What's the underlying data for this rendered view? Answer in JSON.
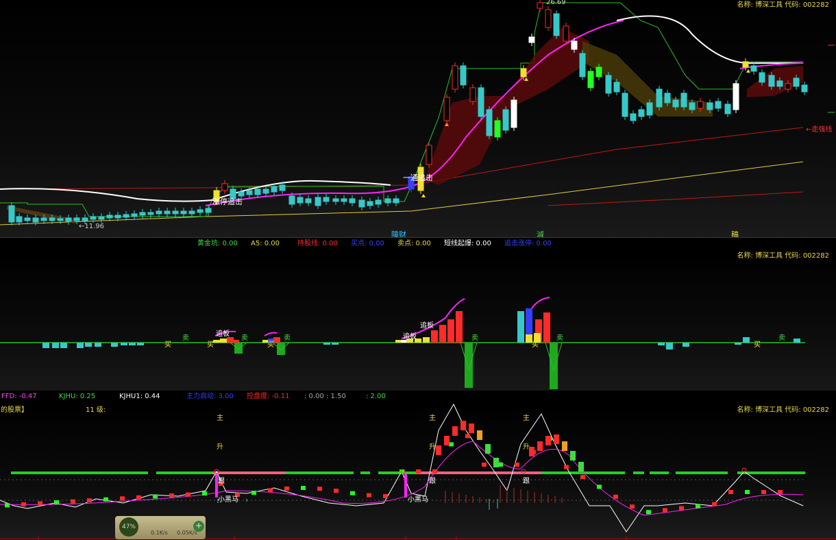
{
  "stock_title": "名称: 博深工具 代码: 002282",
  "panel1": {
    "price_high": "26.69",
    "price_low": "←11.96",
    "right_label": "←走强线",
    "chart_labels": [
      {
        "id": "zhangting",
        "text": "涨停追击"
      },
      {
        "id": "tuo",
        "text": "一通追击"
      }
    ],
    "markers": [
      {
        "id": "m1",
        "text": "障财",
        "color": "#36c9ff"
      },
      {
        "id": "m2",
        "text": "減",
        "color": "#3fdc3f"
      },
      {
        "id": "m3",
        "text": "稿",
        "color": "#e8d84a"
      }
    ],
    "indicator_row": [
      {
        "id": "i1",
        "label": "黄金坑:",
        "value": "0.00",
        "color": "#3fdc3f"
      },
      {
        "id": "i2",
        "label": "A5:",
        "value": "0.00",
        "color": "#e8d84a"
      },
      {
        "id": "i3",
        "label": "持股线:",
        "value": "0.00",
        "color": "#ff2a2a"
      },
      {
        "id": "i4",
        "label": "买点:",
        "value": "0.00",
        "color": "#3340ff"
      },
      {
        "id": "i5",
        "label": "卖点:",
        "value": "0.00",
        "color": "#e8d84a"
      },
      {
        "id": "i6",
        "label": "短线起爆:",
        "value": "0.00",
        "color": "#ffffff"
      },
      {
        "id": "i7",
        "label": "追击涨停:",
        "value": "0.00",
        "color": "#3340ff"
      }
    ]
  },
  "panel2": {
    "labels": {
      "zhuiban": "追板",
      "buy": "买",
      "sell": "卖"
    },
    "indicator_row": [
      {
        "id": "j1",
        "label": "FFD:",
        "value": "-0.47",
        "color": "#ff44ff"
      },
      {
        "id": "j2",
        "label": "KJHU:",
        "value": "0.25",
        "color": "#3fdc3f"
      },
      {
        "id": "j3",
        "label": "KJHU1:",
        "value": "0.44",
        "color": "#ffffff"
      },
      {
        "id": "j4",
        "label": "主力启动:",
        "value": "3.00",
        "color": "#3340ff"
      },
      {
        "id": "j5",
        "label": "控盘度:",
        "value": "-0.11",
        "color": "#ff2a2a"
      },
      {
        "id": "j6",
        "label": ":",
        "value": "0.00 : 1.50",
        "color": "#aaaaaa"
      },
      {
        "id": "j7",
        "label": ":",
        "value": "2.00",
        "color": "#3fdc3f"
      }
    ]
  },
  "panel3": {
    "top_left": "的股票】",
    "level": "11   级:",
    "labels": {
      "zhu": "主",
      "sheng": "升",
      "xiaoheima": "小黑马",
      "gen": "跟"
    }
  },
  "widget": {
    "percent": "47%",
    "up": "0.1K/s",
    "down": "0.05K/s",
    "plus": "+"
  },
  "colors": {
    "up": "#ff2a2a",
    "down": "#36c9c9",
    "accent": "#e8d84a",
    "ma": "#ff22ff"
  }
}
